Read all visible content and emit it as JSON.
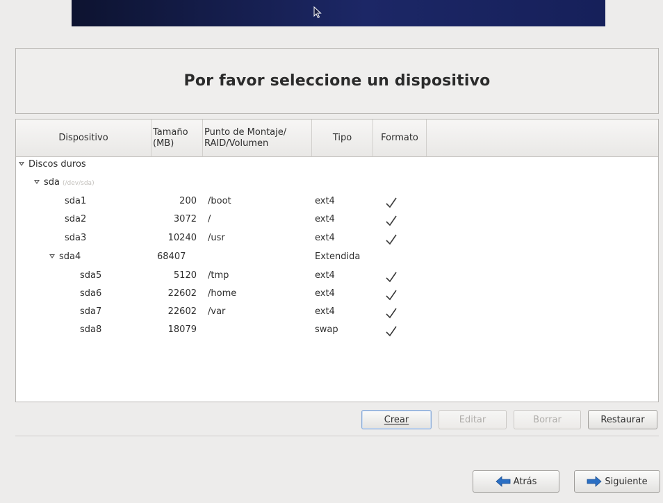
{
  "header": {
    "title": "Por favor seleccione un dispositivo"
  },
  "columns": [
    "Dispositivo",
    "Tamaño\n(MB)",
    "Punto de Montaje/\nRAID/Volumen",
    "Tipo",
    "Formato"
  ],
  "tree": {
    "root_label": "Discos duros",
    "disk": {
      "label": "sda",
      "path": "(/dev/sda)"
    },
    "rows": [
      {
        "device": "sda1",
        "size": "200",
        "mount": "/boot",
        "type": "ext4",
        "format": true
      },
      {
        "device": "sda2",
        "size": "3072",
        "mount": "/",
        "type": "ext4",
        "format": true
      },
      {
        "device": "sda3",
        "size": "10240",
        "mount": "/usr",
        "type": "ext4",
        "format": true
      },
      {
        "device": "sda4",
        "size": "68407",
        "mount": "",
        "type": "Extendida",
        "format": false
      },
      {
        "device": "sda5",
        "size": "5120",
        "mount": "/tmp",
        "type": "ext4",
        "format": true
      },
      {
        "device": "sda6",
        "size": "22602",
        "mount": "/home",
        "type": "ext4",
        "format": true
      },
      {
        "device": "sda7",
        "size": "22602",
        "mount": "/var",
        "type": "ext4",
        "format": true
      },
      {
        "device": "sda8",
        "size": "18079",
        "mount": "",
        "type": "swap",
        "format": true
      }
    ]
  },
  "actions": {
    "create": "Crear",
    "edit": "Editar",
    "delete": "Borrar",
    "reset": "Restaurar"
  },
  "nav": {
    "back": "Atrás",
    "next": "Siguiente"
  },
  "colors": {
    "banner": "#1c2766",
    "check": "#3a3a3a",
    "arrow": "#2a6fc4"
  }
}
